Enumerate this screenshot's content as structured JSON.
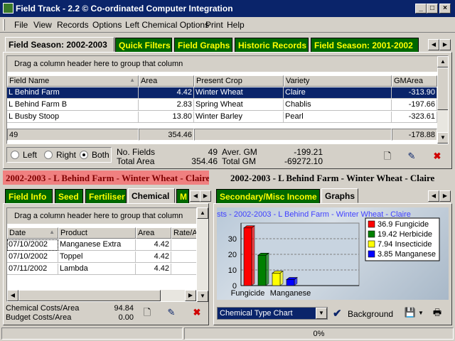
{
  "window": {
    "title": "Field Track - 2.2 © Co-ordinated Computer Integration",
    "min": "_",
    "max": "□",
    "close": "×"
  },
  "menu": [
    "File",
    "View",
    "Records",
    "Options",
    "Left Chemical Options",
    "Print",
    "Help"
  ],
  "top_tabs": [
    "Field Season: 2002-2003",
    "Quick Filters",
    "Field Graphs",
    "Historic Records",
    "Field Season: 2001-2002"
  ],
  "top_grid": {
    "group_text": "Drag a column header here to group that column",
    "columns": [
      "Field Name",
      "Area",
      "Present Crop",
      "Variety",
      "GMArea"
    ],
    "rows": [
      [
        "L Behind Farm",
        "4.42",
        "Winter Wheat",
        "Claire",
        "-313.90"
      ],
      [
        "L Behind Farm B",
        "2.83",
        "Spring Wheat",
        "Chablis",
        "-197.66"
      ],
      [
        "L Busby Stoop",
        "13.80",
        "Winter Barley",
        "Pearl",
        "-323.61"
      ]
    ],
    "footer": {
      "count": "49",
      "area": "354.46",
      "gm": "-178.88"
    }
  },
  "filter": {
    "left": "Left",
    "right": "Right",
    "both": "Both",
    "selected": "both"
  },
  "summary": {
    "no_fields_label": "No. Fields",
    "no_fields": "49",
    "total_area_label": "Total Area",
    "total_area": "354.46",
    "aver_gm_label": "Aver. GM",
    "aver_gm": "-199.21",
    "total_gm_label": "Total GM",
    "total_gm": "-69272.10"
  },
  "left_panel": {
    "header": "2002-2003 - L Behind Farm - Winter Wheat - Claire",
    "tabs": [
      "Field Info",
      "Seed",
      "Fertiliser",
      "Chemical",
      "M"
    ],
    "group_text": "Drag a column header here to group that column",
    "columns": [
      "Date",
      "Product",
      "Area",
      "Rate/A"
    ],
    "rows": [
      [
        "07/10/2002",
        "Manganese Extra",
        "4.42",
        ""
      ],
      [
        "07/10/2002",
        "Toppel",
        "4.42",
        ""
      ],
      [
        "07/11/2002",
        "Lambda",
        "4.42",
        ""
      ]
    ],
    "chem_cost_label": "Chemical Costs/Area",
    "chem_cost": "94.84",
    "budget_cost_label": "Budget Costs/Area",
    "budget_cost": "0.00"
  },
  "right_panel": {
    "header": "2002-2003 - L Behind Farm - Winter Wheat - Claire",
    "tabs": [
      "Secondary/Misc Income",
      "Graphs"
    ],
    "chart_title": "sts - 2002-2003 - L Behind Farm - Winter Wheat - Claire",
    "chart_select": "Chemical Type Chart",
    "background_label": "Background"
  },
  "chart_data": {
    "type": "bar",
    "title": "sts - 2002-2003 - L Behind Farm - Winter Wheat - Claire",
    "categories": [
      "Fungicide",
      "Herbicide",
      "Insecticide",
      "Manganese"
    ],
    "tick_labels_x": [
      "Fungicide",
      "Manganese"
    ],
    "values": [
      36.9,
      19.42,
      7.94,
      3.85
    ],
    "legend": [
      "36.9 Fungicide",
      "19.42 Herbicide",
      "7.94 Insecticide",
      "3.85 Manganese"
    ],
    "colors": [
      "#ff0000",
      "#008000",
      "#ffff00",
      "#0000ff"
    ],
    "ylim": [
      0,
      40
    ],
    "yticks": [
      "0",
      "10",
      "20",
      "30"
    ],
    "legend_position": "top-right",
    "grid": true
  },
  "status": {
    "progress": "0%"
  }
}
